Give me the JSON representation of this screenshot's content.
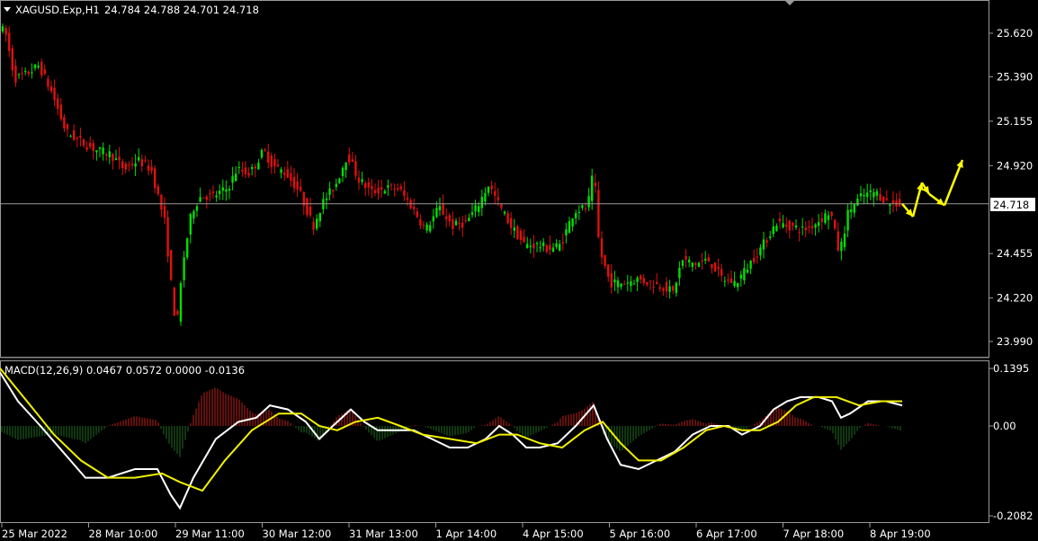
{
  "header": {
    "symbol": "XAGUSD.Exp,H1",
    "ohlc": "24.784 24.788 24.701 24.718"
  },
  "macd_header": "MACD(12,26,9) 0.0467 0.0572 0.0000 -0.0136",
  "price_axis": {
    "ticks": [
      "25.620",
      "25.390",
      "25.155",
      "24.920",
      "24.455",
      "24.220",
      "23.990"
    ],
    "current_price": "24.718"
  },
  "macd_axis": {
    "ticks": [
      "0.1395",
      "0.00",
      "-0.2082"
    ]
  },
  "time_axis": {
    "labels": [
      "25 Mar 2022",
      "28 Mar 10:00",
      "29 Mar 11:00",
      "30 Mar 12:00",
      "31 Mar 13:00",
      "1 Apr 14:00",
      "4 Apr 15:00",
      "5 Apr 16:00",
      "6 Apr 17:00",
      "7 Apr 18:00",
      "8 Apr 19:00"
    ]
  },
  "colors": {
    "background": "#000000",
    "bull": "#00e000",
    "bear": "#e01010",
    "macd_line": "#ffffff",
    "signal_line": "#f0f000",
    "hist_pos": "#c0201a",
    "hist_neg": "#1f6e1f",
    "arrow": "#ffff00",
    "grid": "#9a9a9a"
  },
  "chart_data": {
    "type": "candlestick",
    "price_range": [
      23.93,
      25.77
    ],
    "macd_range": [
      -0.2082,
      0.1395
    ],
    "price_path": [
      [
        0,
        25.66
      ],
      [
        8,
        25.62
      ],
      [
        18,
        25.38
      ],
      [
        30,
        25.4
      ],
      [
        45,
        25.45
      ],
      [
        60,
        25.3
      ],
      [
        75,
        25.1
      ],
      [
        90,
        25.05
      ],
      [
        110,
        25.0
      ],
      [
        125,
        24.98
      ],
      [
        140,
        24.9
      ],
      [
        155,
        24.95
      ],
      [
        170,
        24.9
      ],
      [
        185,
        24.62
      ],
      [
        193,
        24.25
      ],
      [
        198,
        24.05
      ],
      [
        205,
        24.4
      ],
      [
        215,
        24.68
      ],
      [
        225,
        24.76
      ],
      [
        240,
        24.76
      ],
      [
        255,
        24.8
      ],
      [
        265,
        24.9
      ],
      [
        280,
        24.88
      ],
      [
        295,
        25.0
      ],
      [
        305,
        24.92
      ],
      [
        320,
        24.88
      ],
      [
        335,
        24.78
      ],
      [
        350,
        24.6
      ],
      [
        360,
        24.72
      ],
      [
        375,
        24.82
      ],
      [
        388,
        24.98
      ],
      [
        400,
        24.85
      ],
      [
        415,
        24.78
      ],
      [
        430,
        24.8
      ],
      [
        445,
        24.8
      ],
      [
        460,
        24.7
      ],
      [
        475,
        24.58
      ],
      [
        490,
        24.7
      ],
      [
        505,
        24.6
      ],
      [
        520,
        24.62
      ],
      [
        532,
        24.7
      ],
      [
        545,
        24.82
      ],
      [
        558,
        24.7
      ],
      [
        570,
        24.6
      ],
      [
        585,
        24.5
      ],
      [
        600,
        24.5
      ],
      [
        612,
        24.48
      ],
      [
        625,
        24.5
      ],
      [
        640,
        24.68
      ],
      [
        655,
        24.7
      ],
      [
        662,
        24.9
      ],
      [
        668,
        24.48
      ],
      [
        680,
        24.3
      ],
      [
        695,
        24.3
      ],
      [
        710,
        24.32
      ],
      [
        725,
        24.3
      ],
      [
        740,
        24.28
      ],
      [
        750,
        24.25
      ],
      [
        760,
        24.42
      ],
      [
        775,
        24.4
      ],
      [
        790,
        24.42
      ],
      [
        805,
        24.32
      ],
      [
        820,
        24.3
      ],
      [
        835,
        24.4
      ],
      [
        850,
        24.5
      ],
      [
        865,
        24.62
      ],
      [
        880,
        24.6
      ],
      [
        895,
        24.58
      ],
      [
        910,
        24.62
      ],
      [
        925,
        24.68
      ],
      [
        935,
        24.45
      ],
      [
        945,
        24.68
      ],
      [
        960,
        24.76
      ],
      [
        975,
        24.78
      ],
      [
        990,
        24.72
      ],
      [
        1003,
        24.718
      ]
    ],
    "macd_path": [
      [
        0,
        0.13
      ],
      [
        20,
        0.06
      ],
      [
        45,
        0.0
      ],
      [
        70,
        -0.06
      ],
      [
        95,
        -0.12
      ],
      [
        120,
        -0.12
      ],
      [
        150,
        -0.1
      ],
      [
        175,
        -0.1
      ],
      [
        190,
        -0.16
      ],
      [
        200,
        -0.19
      ],
      [
        215,
        -0.12
      ],
      [
        240,
        -0.03
      ],
      [
        265,
        0.01
      ],
      [
        285,
        0.02
      ],
      [
        300,
        0.05
      ],
      [
        320,
        0.04
      ],
      [
        340,
        0.01
      ],
      [
        355,
        -0.03
      ],
      [
        370,
        0.0
      ],
      [
        390,
        0.04
      ],
      [
        405,
        0.01
      ],
      [
        420,
        -0.01
      ],
      [
        440,
        -0.01
      ],
      [
        460,
        -0.01
      ],
      [
        480,
        -0.03
      ],
      [
        500,
        -0.05
      ],
      [
        520,
        -0.05
      ],
      [
        540,
        -0.03
      ],
      [
        555,
        0.0
      ],
      [
        570,
        -0.02
      ],
      [
        585,
        -0.05
      ],
      [
        600,
        -0.05
      ],
      [
        620,
        -0.04
      ],
      [
        640,
        0.0
      ],
      [
        660,
        0.05
      ],
      [
        675,
        -0.03
      ],
      [
        690,
        -0.09
      ],
      [
        710,
        -0.1
      ],
      [
        730,
        -0.08
      ],
      [
        750,
        -0.06
      ],
      [
        770,
        -0.02
      ],
      [
        790,
        0.0
      ],
      [
        810,
        0.0
      ],
      [
        825,
        -0.02
      ],
      [
        845,
        0.0
      ],
      [
        860,
        0.04
      ],
      [
        875,
        0.06
      ],
      [
        890,
        0.07
      ],
      [
        910,
        0.07
      ],
      [
        925,
        0.06
      ],
      [
        935,
        0.02
      ],
      [
        945,
        0.03
      ],
      [
        965,
        0.06
      ],
      [
        985,
        0.06
      ],
      [
        1003,
        0.05
      ]
    ],
    "signal_path": [
      [
        0,
        0.14
      ],
      [
        30,
        0.06
      ],
      [
        60,
        -0.02
      ],
      [
        90,
        -0.08
      ],
      [
        120,
        -0.12
      ],
      [
        150,
        -0.12
      ],
      [
        180,
        -0.11
      ],
      [
        200,
        -0.13
      ],
      [
        225,
        -0.15
      ],
      [
        250,
        -0.08
      ],
      [
        280,
        -0.01
      ],
      [
        310,
        0.03
      ],
      [
        335,
        0.03
      ],
      [
        355,
        0.0
      ],
      [
        375,
        -0.01
      ],
      [
        395,
        0.01
      ],
      [
        420,
        0.02
      ],
      [
        445,
        0.0
      ],
      [
        470,
        -0.02
      ],
      [
        500,
        -0.03
      ],
      [
        530,
        -0.04
      ],
      [
        555,
        -0.02
      ],
      [
        575,
        -0.02
      ],
      [
        600,
        -0.04
      ],
      [
        625,
        -0.05
      ],
      [
        650,
        -0.01
      ],
      [
        670,
        0.01
      ],
      [
        690,
        -0.04
      ],
      [
        710,
        -0.08
      ],
      [
        735,
        -0.08
      ],
      [
        760,
        -0.05
      ],
      [
        785,
        -0.01
      ],
      [
        805,
        0.0
      ],
      [
        825,
        -0.01
      ],
      [
        845,
        -0.01
      ],
      [
        865,
        0.01
      ],
      [
        885,
        0.05
      ],
      [
        905,
        0.07
      ],
      [
        930,
        0.07
      ],
      [
        955,
        0.05
      ],
      [
        980,
        0.06
      ],
      [
        1003,
        0.06
      ]
    ],
    "forecast_arrows": [
      [
        [
          1003,
          24.718
        ],
        [
          1015,
          24.65
        ],
        [
          1025,
          24.83
        ],
        [
          1033,
          24.77
        ],
        [
          1050,
          24.71
        ],
        [
          1070,
          24.95
        ]
      ]
    ]
  }
}
